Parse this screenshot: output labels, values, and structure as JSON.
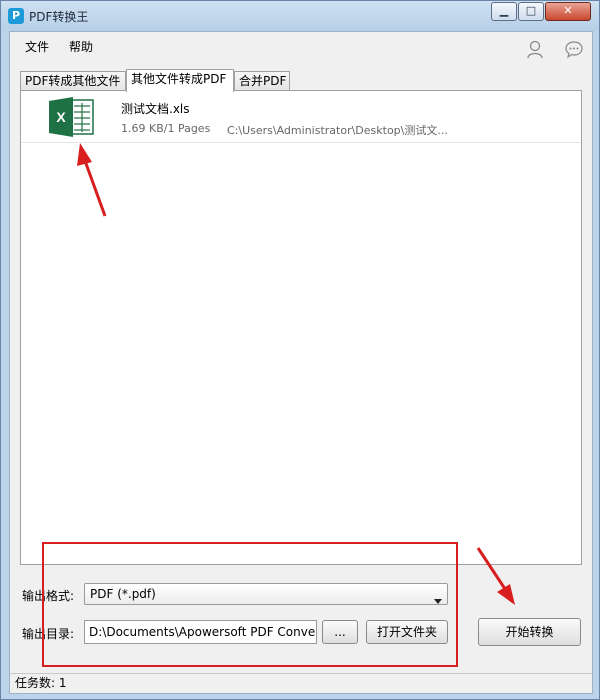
{
  "window": {
    "title": "PDF转换王"
  },
  "window_controls": {
    "minimize": "▁",
    "maximize": "□",
    "close": "✕"
  },
  "menu": {
    "file": "文件",
    "help": "帮助"
  },
  "tabs": [
    {
      "label": "PDF转成其他文件"
    },
    {
      "label": "其他文件转成PDF"
    },
    {
      "label": "合并PDF"
    }
  ],
  "file_list": [
    {
      "name": "测试文档.xls",
      "meta": "1.69 KB/1 Pages",
      "path": "C:\\Users\\Administrator\\Desktop\\测试文..."
    }
  ],
  "output": {
    "format_label": "输出格式:",
    "format_value": "PDF (*.pdf)",
    "dir_label": "输出目录:",
    "dir_value": "D:\\Documents\\Apowersoft PDF Conver",
    "browse_label": "...",
    "open_folder_label": "打开文件夹"
  },
  "start_button": "开始转换",
  "status": {
    "task_count": "任务数: 1"
  },
  "colors": {
    "accent": "#1c9bd8",
    "excel_green": "#1e7145",
    "annotation": "#d81e1e"
  }
}
